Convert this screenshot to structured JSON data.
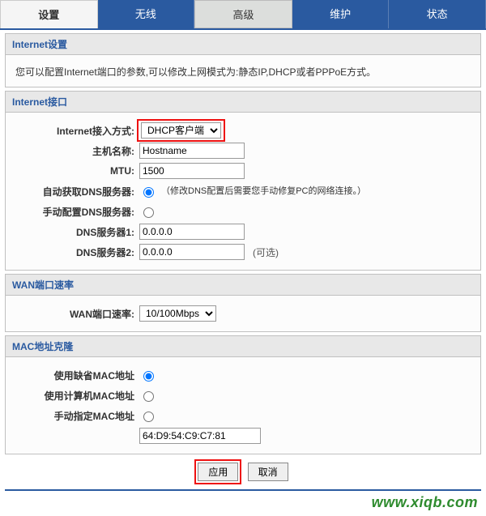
{
  "tabs": {
    "settings": "设置",
    "wireless": "无线",
    "advanced": "高级",
    "maintenance": "维护",
    "status": "状态"
  },
  "sections": {
    "internetSettings": {
      "title": "Internet设置",
      "desc": "您可以配置Internet端口的参数,可以修改上网模式为:静态IP,DHCP或者PPPoE方式。"
    },
    "internetPort": {
      "title": "Internet接口",
      "fields": {
        "accessModeLabel": "Internet接入方式:",
        "accessModeValue": "DHCP客户端",
        "hostnameLabel": "主机名称:",
        "hostnameValue": "Hostname",
        "mtuLabel": "MTU:",
        "mtuValue": "1500",
        "autoDnsLabel": "自动获取DNS服务器:",
        "autoDnsNote": "（修改DNS配置后需要您手动修复PC的网络连接。）",
        "manualDnsLabel": "手动配置DNS服务器:",
        "dns1Label": "DNS服务器1:",
        "dns1Value": "0.0.0.0",
        "dns2Label": "DNS服务器2:",
        "dns2Value": "0.0.0.0",
        "dns2Optional": "(可选)"
      }
    },
    "wanSpeed": {
      "title": "WAN端口速率",
      "label": "WAN端口速率:",
      "value": "10/100Mbps"
    },
    "macClone": {
      "title": "MAC地址克隆",
      "defaultMacLabel": "使用缺省MAC地址",
      "pcMacLabel": "使用计算机MAC地址",
      "manualMacLabel": "手动指定MAC地址",
      "manualMacValue": "64:D9:54:C9:C7:81"
    }
  },
  "buttons": {
    "apply": "应用",
    "cancel": "取消"
  },
  "watermark": "www.xiqb.com"
}
